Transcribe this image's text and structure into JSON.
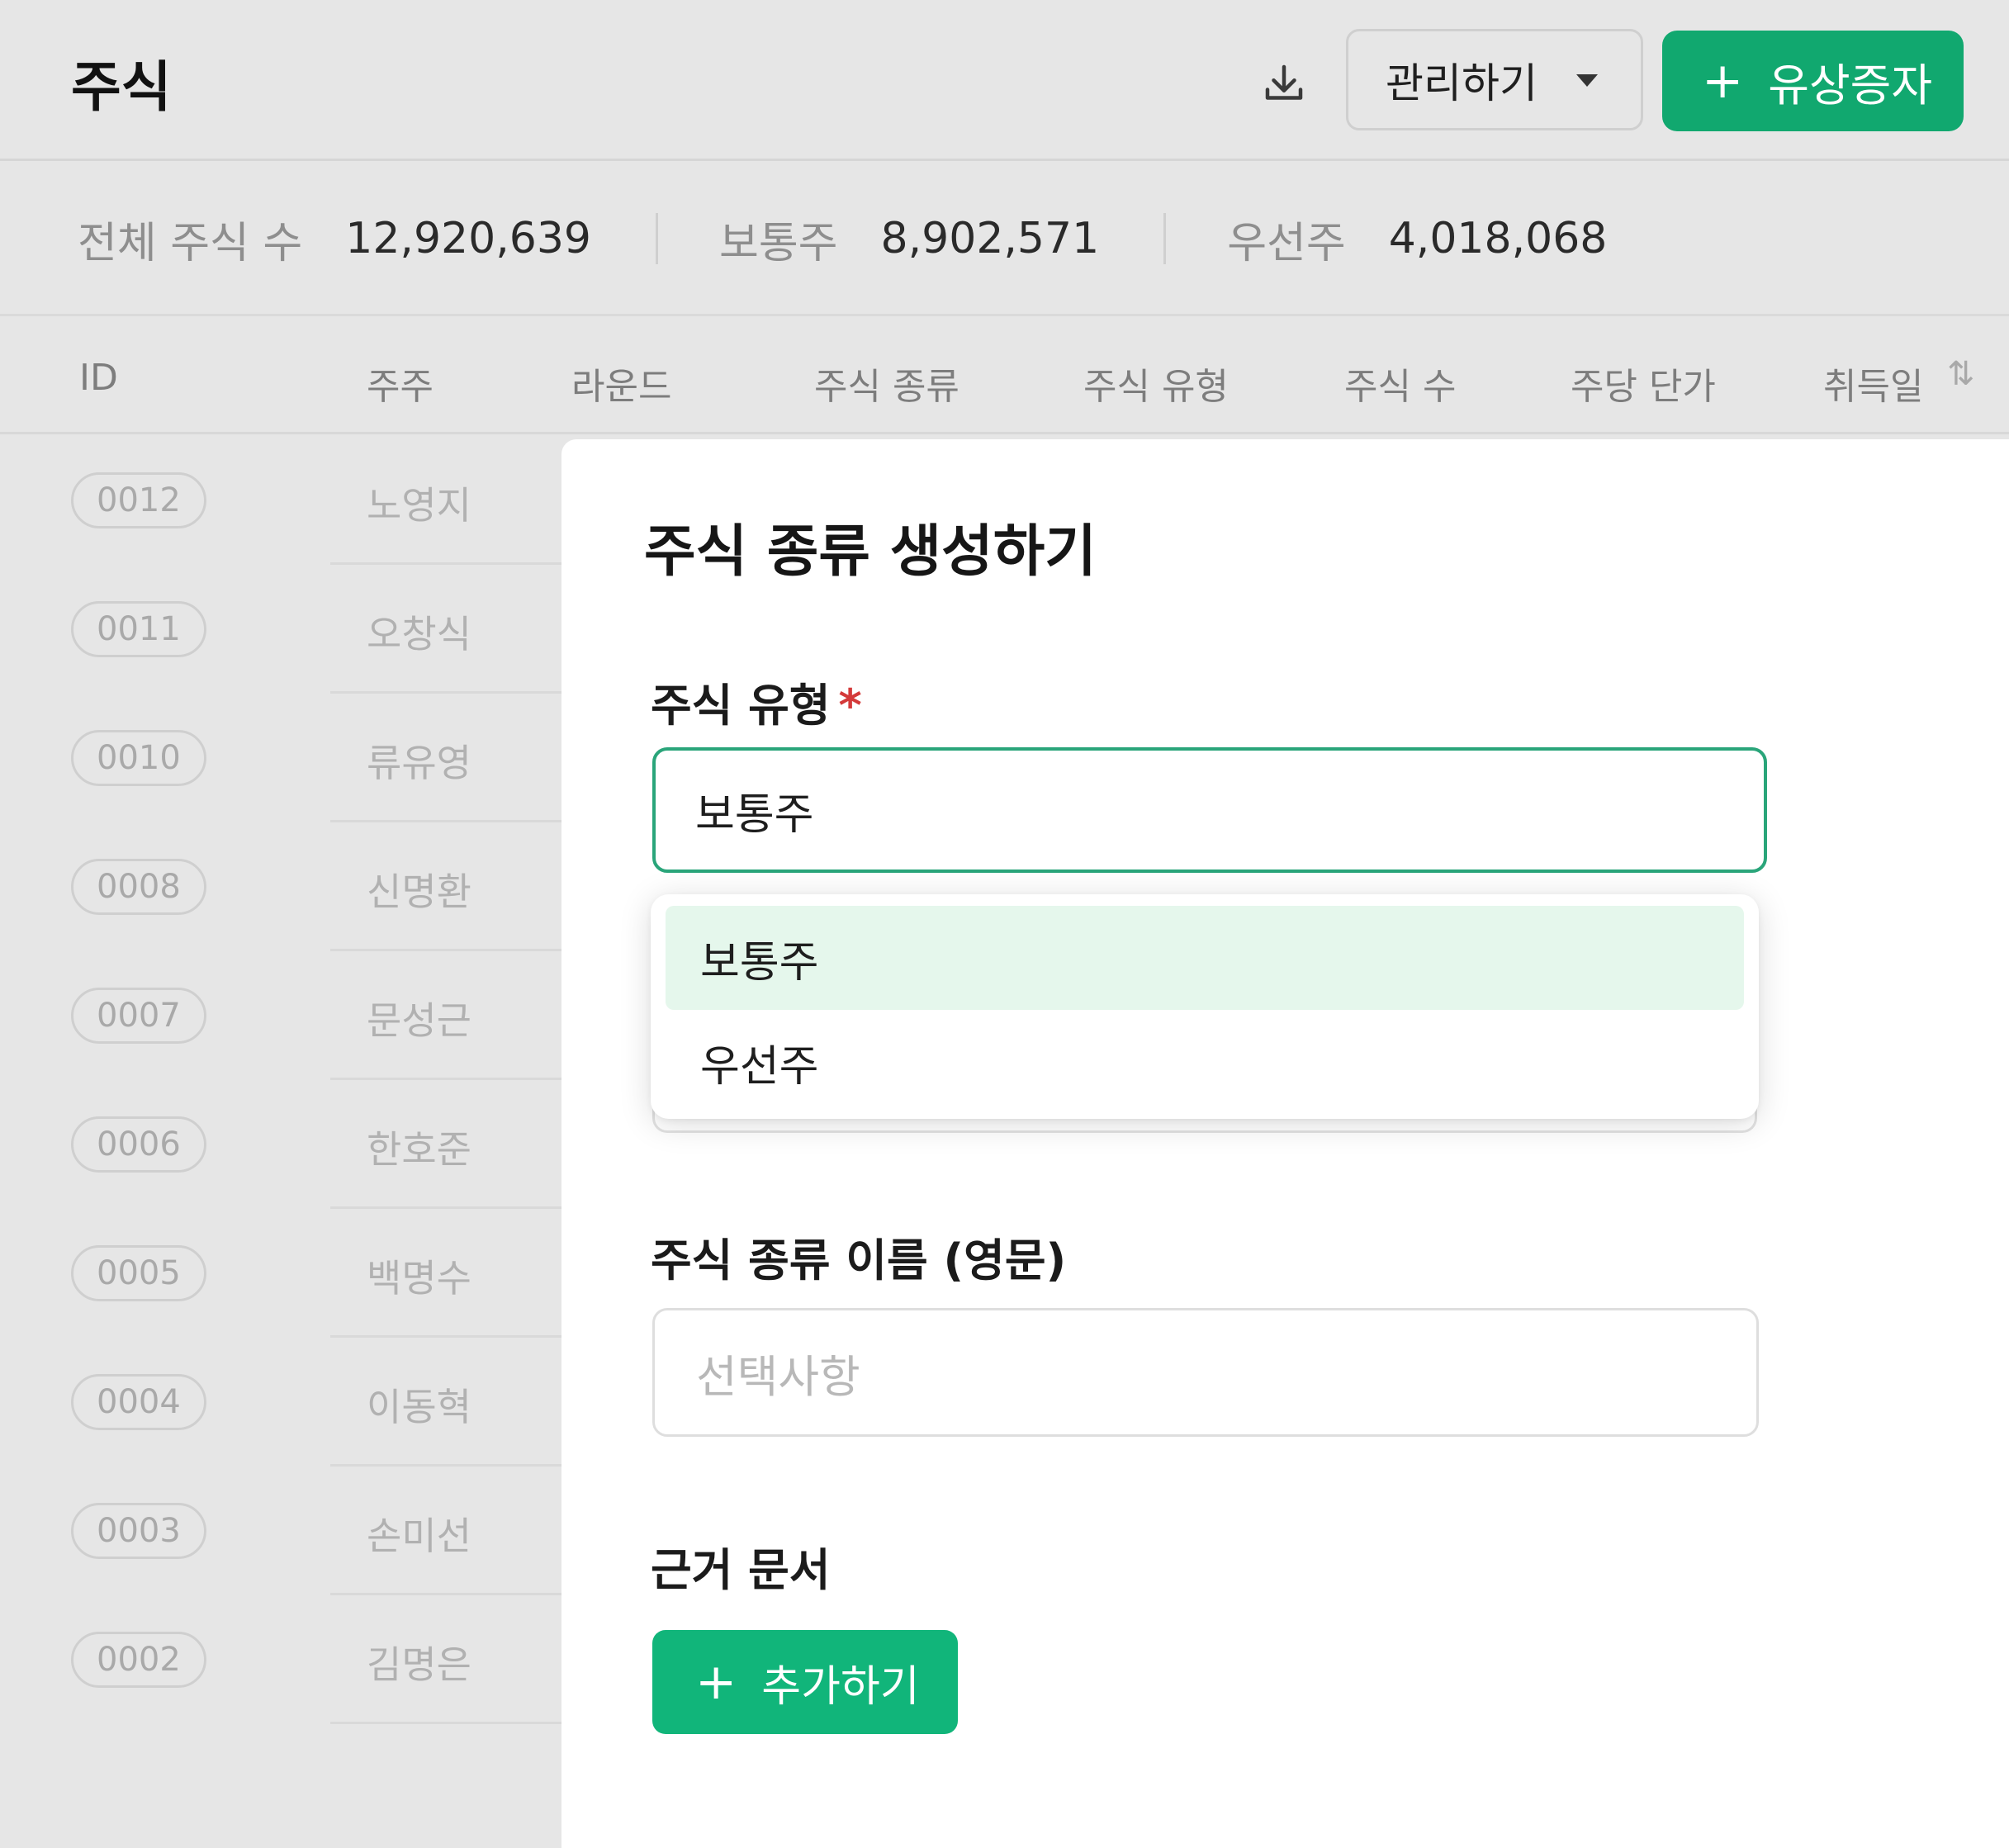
{
  "header": {
    "title": "주식",
    "download_icon": "download-icon",
    "manage_label": "관리하기",
    "capital_increase_label": "유상증자"
  },
  "summary": {
    "total_label": "전체 주식 수",
    "total_value": "12,920,639",
    "common_label": "보통주",
    "common_value": "8,902,571",
    "preferred_label": "우선주",
    "preferred_value": "4,018,068"
  },
  "table": {
    "columns": [
      "ID",
      "주주",
      "라운드",
      "주식 종류",
      "주식 유형",
      "주식 수",
      "주당 단가",
      "취득일"
    ],
    "sort_icon": "sort-arrows-icon",
    "rows": [
      {
        "id": "0012",
        "holder": "노영지"
      },
      {
        "id": "0011",
        "holder": "오창식"
      },
      {
        "id": "0010",
        "holder": "류유영"
      },
      {
        "id": "0008",
        "holder": "신명환"
      },
      {
        "id": "0007",
        "holder": "문성근"
      },
      {
        "id": "0006",
        "holder": "한호준"
      },
      {
        "id": "0005",
        "holder": "백명수"
      },
      {
        "id": "0004",
        "holder": "이동혁"
      },
      {
        "id": "0003",
        "holder": "손미선"
      },
      {
        "id": "0002",
        "holder": "김명은"
      }
    ]
  },
  "panel": {
    "title": "주식 종류 생성하기",
    "type_label": "주식 유형",
    "required_mark": "*",
    "type_value": "보통주",
    "type_options": [
      "보통주",
      "우선주"
    ],
    "name_label": "주식 종류 이름 (영문)",
    "name_placeholder": "선택사항",
    "docs_label": "근거 문서",
    "add_label": "추가하기"
  },
  "colors": {
    "accent_green": "#11a86f",
    "focus_border": "#2aa57a",
    "selected_option_bg": "#e5f7ec",
    "required_red": "#d43a3a"
  }
}
